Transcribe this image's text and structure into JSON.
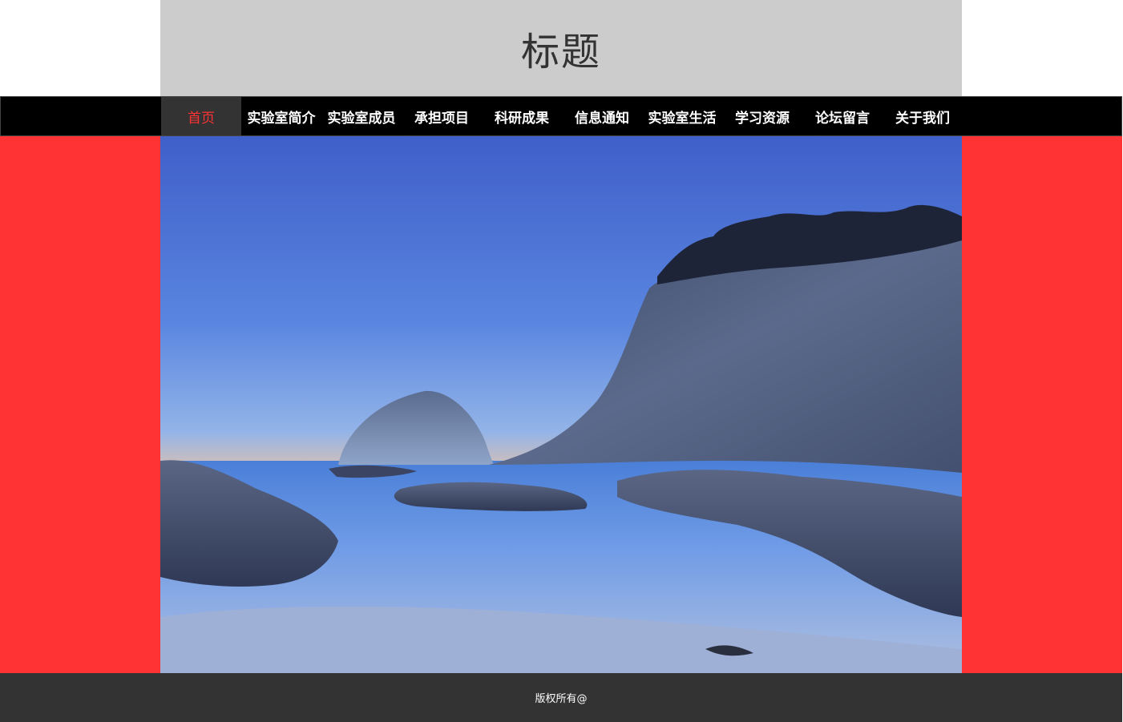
{
  "header": {
    "title": "标题"
  },
  "nav": {
    "items": [
      {
        "label": "首页",
        "active": true
      },
      {
        "label": "实验室简介",
        "active": false
      },
      {
        "label": "实验室成员",
        "active": false
      },
      {
        "label": "承担项目",
        "active": false
      },
      {
        "label": "科研成果",
        "active": false
      },
      {
        "label": "信息通知",
        "active": false
      },
      {
        "label": "实验室生活",
        "active": false
      },
      {
        "label": "学习资源",
        "active": false
      },
      {
        "label": "论坛留言",
        "active": false
      },
      {
        "label": "关于我们",
        "active": false
      }
    ]
  },
  "colors": {
    "header_bg": "#cccccc",
    "nav_bg": "#000000",
    "nav_active_bg": "#333333",
    "nav_active_text": "#ff3333",
    "main_bg": "#ff3333",
    "footer_bg": "#333333"
  },
  "footer": {
    "copyright": "版权所有@"
  }
}
